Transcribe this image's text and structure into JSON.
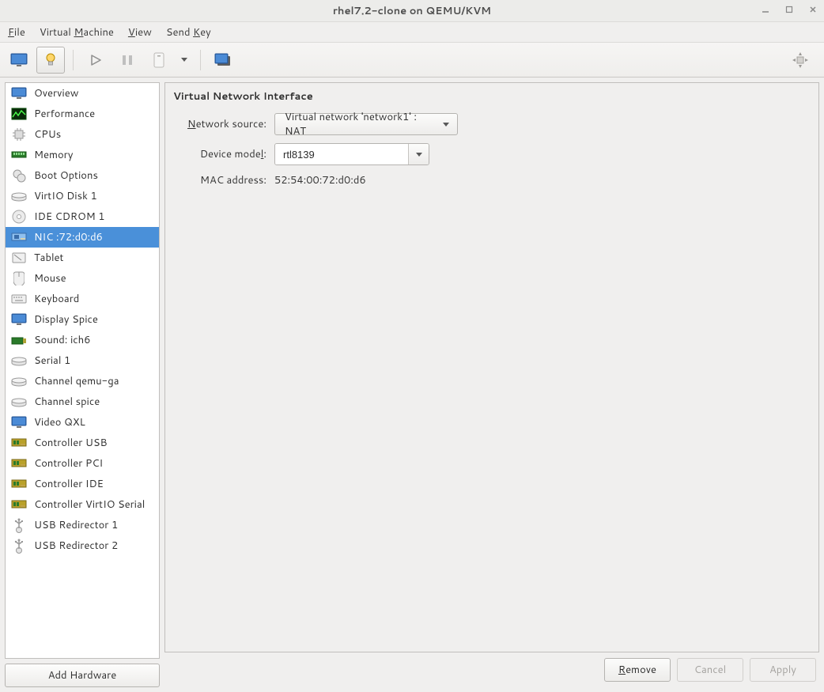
{
  "window": {
    "title": "rhel7.2-clone on QEMU/KVM"
  },
  "menubar": {
    "file": "File",
    "vm": "Virtual Machine",
    "view": "View",
    "sendkey": "Send Key"
  },
  "sidebar": {
    "items": [
      {
        "icon": "monitor",
        "label": "Overview"
      },
      {
        "icon": "perf",
        "label": "Performance"
      },
      {
        "icon": "cpu",
        "label": "CPUs"
      },
      {
        "icon": "mem",
        "label": "Memory"
      },
      {
        "icon": "boot",
        "label": "Boot Options"
      },
      {
        "icon": "disk",
        "label": "VirtIO Disk 1"
      },
      {
        "icon": "cdrom",
        "label": "IDE CDROM 1"
      },
      {
        "icon": "nic",
        "label": "NIC :72:d0:d6",
        "selected": true
      },
      {
        "icon": "tablet",
        "label": "Tablet"
      },
      {
        "icon": "mouse",
        "label": "Mouse"
      },
      {
        "icon": "keyboard",
        "label": "Keyboard"
      },
      {
        "icon": "display",
        "label": "Display Spice"
      },
      {
        "icon": "sound",
        "label": "Sound: ich6"
      },
      {
        "icon": "serial",
        "label": "Serial 1"
      },
      {
        "icon": "serial",
        "label": "Channel qemu-ga"
      },
      {
        "icon": "serial",
        "label": "Channel spice"
      },
      {
        "icon": "video",
        "label": "Video QXL"
      },
      {
        "icon": "controller",
        "label": "Controller USB"
      },
      {
        "icon": "controller",
        "label": "Controller PCI"
      },
      {
        "icon": "controller",
        "label": "Controller IDE"
      },
      {
        "icon": "controller",
        "label": "Controller VirtIO Serial"
      },
      {
        "icon": "usb",
        "label": "USB Redirector 1"
      },
      {
        "icon": "usb",
        "label": "USB Redirector 2"
      }
    ]
  },
  "content": {
    "section_title": "Virtual Network Interface",
    "network_source_label": "Network source:",
    "network_source_value": "Virtual network 'network1' : NAT",
    "device_model_label": "Device model:",
    "device_model_value": "rtl8139",
    "mac_label": "MAC address:",
    "mac_value": "52:54:00:72:d0:d6"
  },
  "buttons": {
    "add_hardware": "Add Hardware",
    "remove": "Remove",
    "cancel": "Cancel",
    "apply": "Apply"
  }
}
